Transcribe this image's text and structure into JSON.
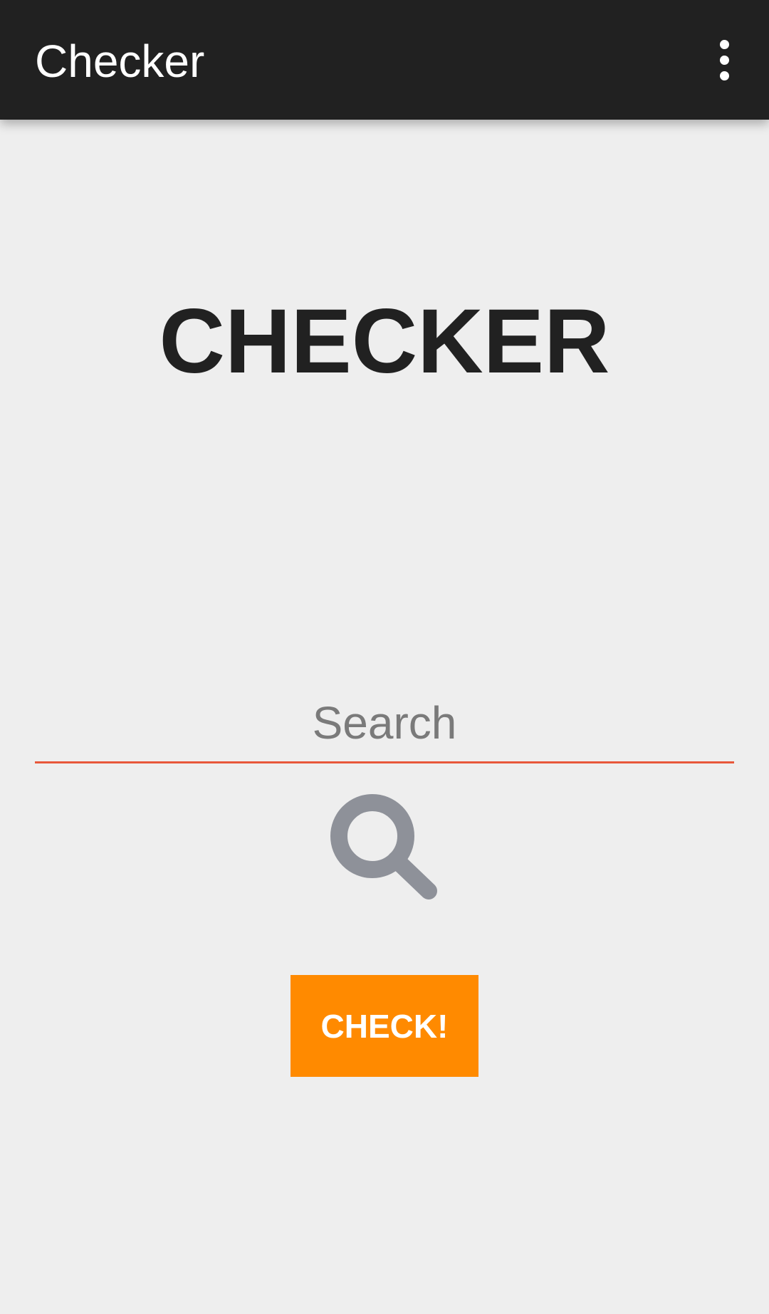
{
  "app_bar": {
    "title": "Checker",
    "overflow_icon": "more-vert-icon",
    "background_color": "#212121"
  },
  "main": {
    "headline": "CHECKER",
    "search": {
      "placeholder": "Search",
      "value": "",
      "underline_color": "#e8573a"
    },
    "search_icon": "search-icon",
    "search_icon_color": "#8e9199",
    "check_button": {
      "label": "CHECK!",
      "color": "#ff8a00"
    }
  }
}
